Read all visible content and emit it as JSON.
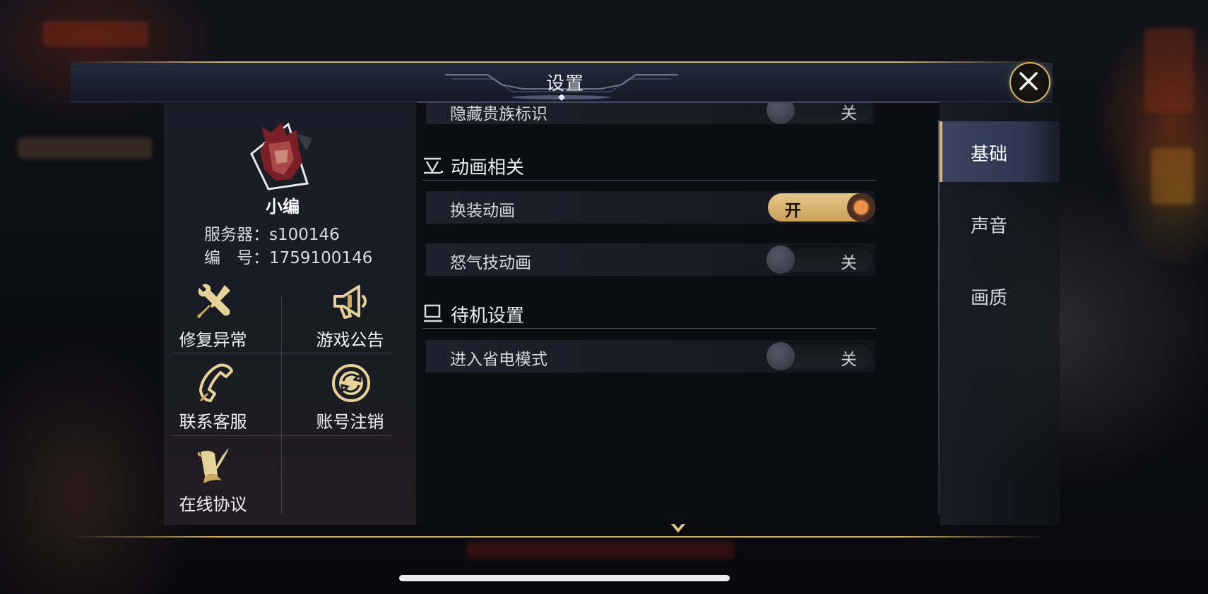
{
  "dialog": {
    "title": "设置"
  },
  "profile": {
    "name": "小编",
    "server_label": "服务器：",
    "server_value": "s100146",
    "id_label": "编　号：",
    "id_value": "1759100146"
  },
  "actions": [
    {
      "label": "修复异常",
      "icon": "wrench-screwdriver-icon"
    },
    {
      "label": "游戏公告",
      "icon": "megaphone-icon"
    },
    {
      "label": "联系客服",
      "icon": "phone-icon"
    },
    {
      "label": "账号注销",
      "icon": "account-cancel-icon"
    },
    {
      "label": "在线协议",
      "icon": "scroll-quill-icon"
    }
  ],
  "settings": {
    "partial_row": {
      "label": "隐藏贵族标识",
      "state": "关",
      "on": false
    },
    "sections": [
      {
        "title": "动画相关",
        "icon": "animation-section-icon",
        "rows": [
          {
            "label": "换装动画",
            "state": "开",
            "on": true
          },
          {
            "label": "怒气技动画",
            "state": "关",
            "on": false
          }
        ]
      },
      {
        "title": "待机设置",
        "icon": "standby-section-icon",
        "rows": [
          {
            "label": "进入省电模式",
            "state": "关",
            "on": false
          }
        ]
      }
    ]
  },
  "tabs": [
    {
      "label": "基础",
      "active": true
    },
    {
      "label": "声音",
      "active": false
    },
    {
      "label": "画质",
      "active": false
    }
  ],
  "colors": {
    "accent_gold": "#d8b875",
    "toggle_on": "#d9b572",
    "toggle_knob_on": "#ee8f4b"
  }
}
